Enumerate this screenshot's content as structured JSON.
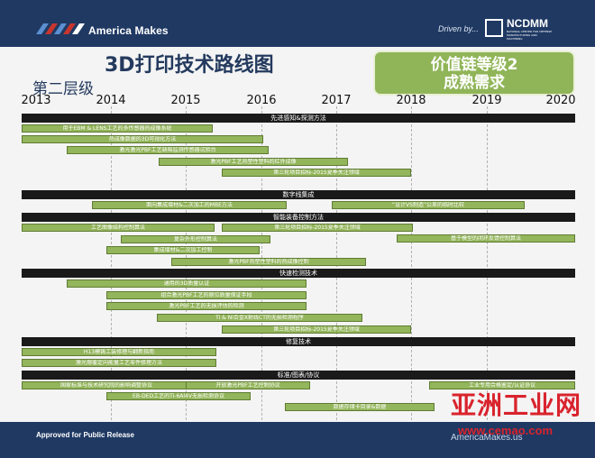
{
  "header": {
    "logo_text": "America Makes",
    "driven_by": "Driven by...",
    "partner_logo": "NCDMM",
    "partner_sub": "NATIONAL CENTER FOR DEFENSE MANUFACTURING AND MACHINING"
  },
  "title": "3D打印技术路线图",
  "subtitle": "第二层级",
  "badge": {
    "line1": "价值链等级2",
    "line2": "成熟需求"
  },
  "years": [
    "2013",
    "2014",
    "2015",
    "2016",
    "2017",
    "2018",
    "2019",
    "2020"
  ],
  "sections": {
    "s1": "先进感知&探测方法",
    "s2": "数字线集成",
    "s3": "智能装备控制方法",
    "s4": "快速检测技术",
    "s5": "修复技术",
    "s6": "标准/图表/协议"
  },
  "bars": {
    "b1": "用于EBM & LENS工艺的多传感器热成像系统",
    "b2": "热成像数据的3D可视化方法",
    "b3": "激光激光PBF工艺缺陷监测传感器试验台",
    "b4": "激光PBF工艺热塑性塑料的红外成像",
    "b5": "第三轮项目招标-2015夏季关注领域",
    "b6": "面向集成增材&二次加工的MBE方法",
    "b7": "“设计VS制造”公差的临时比较",
    "b8": "工艺图像结构控制算法",
    "b9": "第三轮项目招标-2015夏季关注领域",
    "b10": "基于模型的闭环反馈控制算法",
    "b11": "复杂外形控制算法",
    "b12": "集成增材&二次加工控制",
    "b13": "激光PBF热塑性塑料的热成像控制",
    "b14": "通用的3D质量认证",
    "b15": "组合激光PBF工艺的原位质量保证手段",
    "b16": "激光PBF工艺的无损评估的检测",
    "b17": "Ti & Ni合金X射线CT的无损检测程序",
    "b18": "第三轮项目招标-2015夏季关注领域",
    "b19": "H13模铸工装修理与翻新指南",
    "b20": "激光熔覆定向能量工艺零件修理方法",
    "b21": "国家标准与技术研究院的影响调整协议",
    "b22": "开放激光PBF工艺控制协议",
    "b23": "工业专用合格鉴定/认证协议",
    "b24": "EB-DED工艺的Ti-6Al4V无损检测协议",
    "b25": "数据存储卡目录&数据"
  },
  "footer": {
    "release": "Approved for Public Release",
    "site": "AmericaMakes.us"
  },
  "watermark": {
    "cn": "亚洲工业网",
    "url": "www.cemao.com"
  },
  "colors": {
    "navy": "#1f3963",
    "bar_green": "#93b55b",
    "badge_green": "#90b558",
    "header_black": "#1a1a1a"
  }
}
